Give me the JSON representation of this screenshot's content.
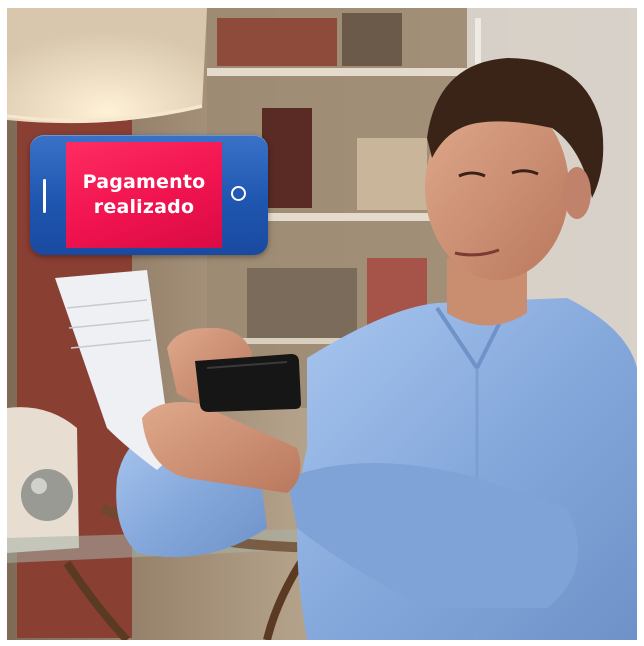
{
  "overlay": {
    "message_line1": "Pagamento",
    "message_line2": "realizado",
    "colors": {
      "phone_body": "#1f56b0",
      "screen": "#f0134f",
      "text": "#ffffff"
    },
    "icons": [
      "side-button-icon",
      "home-button-icon"
    ]
  },
  "scene": {
    "colors": {
      "shirt": "#8fb2e2",
      "wall": "#a48f73",
      "smartphone": "#161616",
      "paper": "#e9ecf2"
    }
  }
}
